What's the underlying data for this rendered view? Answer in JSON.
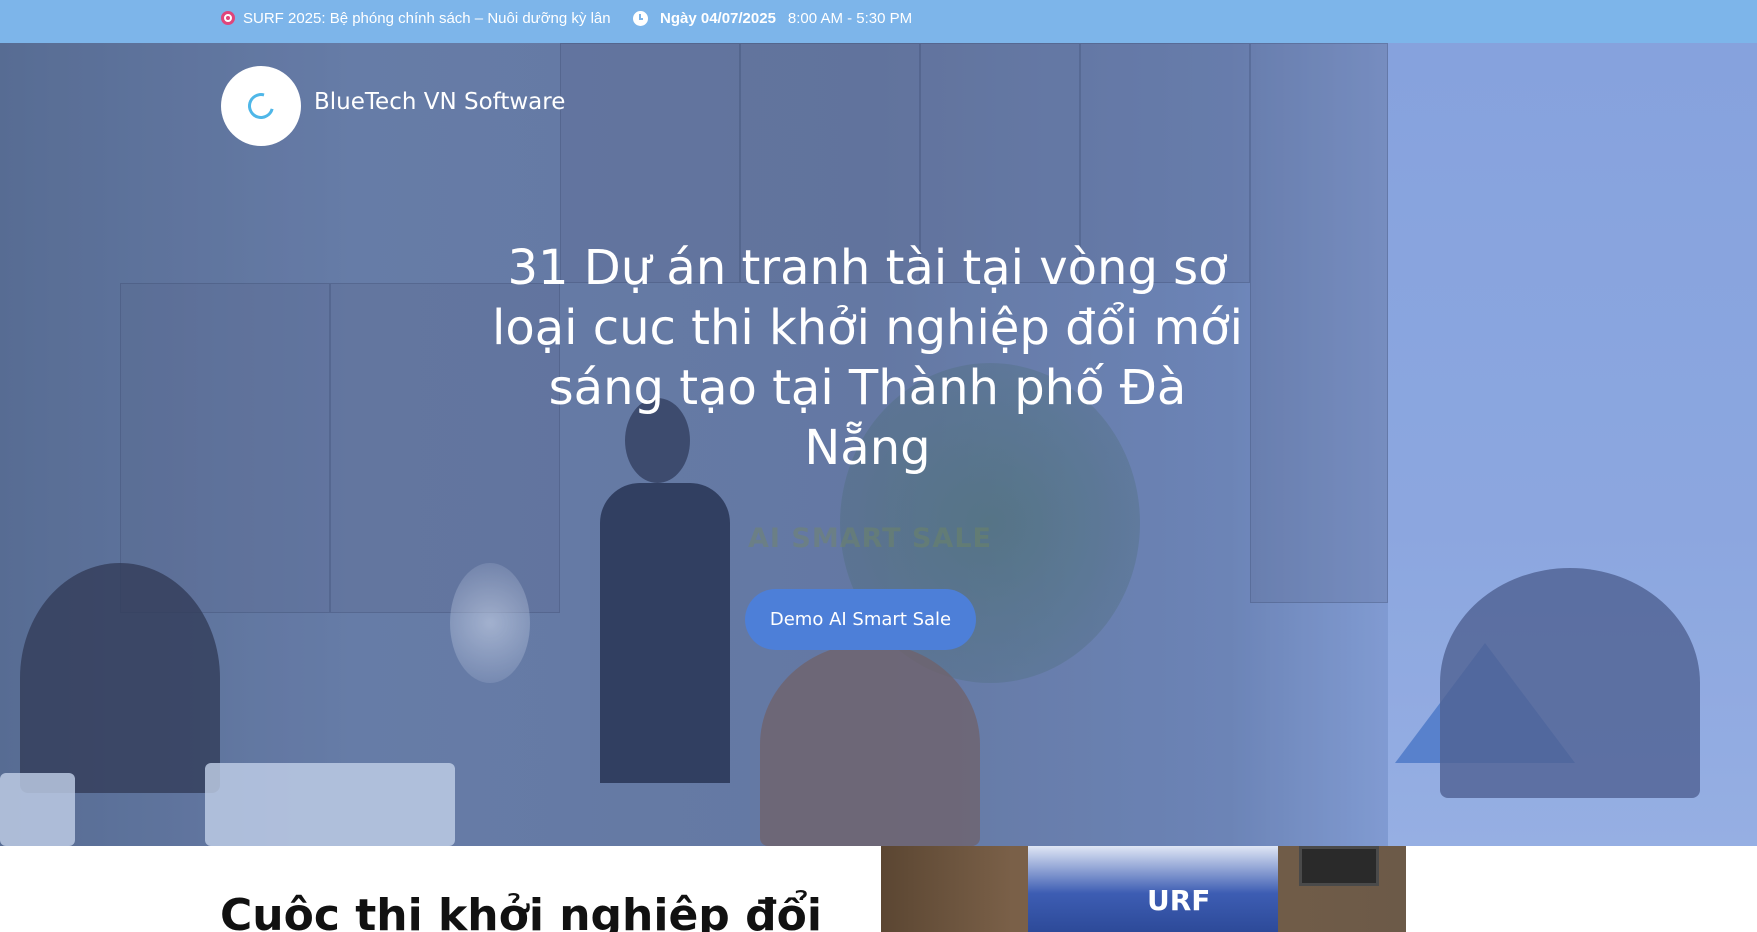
{
  "topbar": {
    "announcement": "SURF 2025: Bệ phóng chính sách – Nuôi dưỡng kỳ lân",
    "date": "Ngày 04/07/2025",
    "time": "8:00 AM - 5:30 PM",
    "icons": {
      "announcement": "target-icon",
      "time": "clock-icon"
    }
  },
  "header": {
    "brand_name": "BlueTech VN Software",
    "logo_icon": "bluetech-logo-icon"
  },
  "hero": {
    "title": "31 Dự án tranh tài tại vòng sơ loại cuc thi khởi nghiệp đổi mới sáng tạo tại Thành phố Đà Nẵng",
    "watermark": "AI SMART SALE",
    "cta_label": "Demo AI Smart Sale"
  },
  "section": {
    "heading": "Cuộc thi khởi nghiệp đổi",
    "photo_banner_text": "URF"
  },
  "colors": {
    "topbar": "#7db5ea",
    "cta": "#4d7fd8",
    "heading": "#111111"
  }
}
